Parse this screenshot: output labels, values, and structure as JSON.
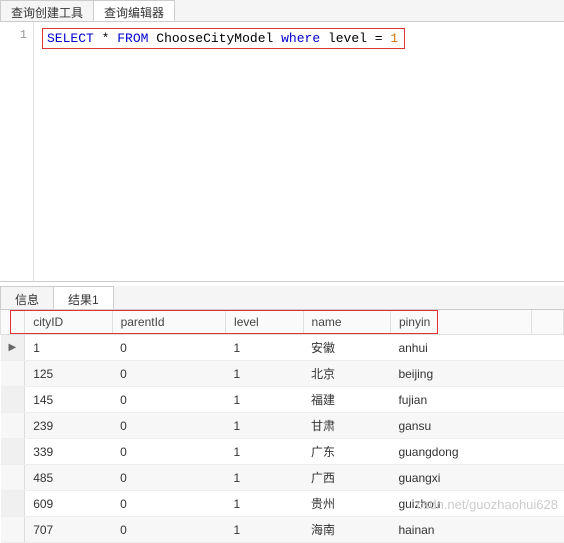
{
  "top_tabs": {
    "create_tool": "查询创建工具",
    "editor": "查询编辑器"
  },
  "editor": {
    "line_number": "1",
    "sql": {
      "kw_select": "SELECT",
      "star": "*",
      "kw_from": "FROM",
      "table": "ChooseCityModel",
      "kw_where": "where",
      "col": "level",
      "eq": "=",
      "val": "1"
    }
  },
  "result_tabs": {
    "info": "信息",
    "result1": "结果1"
  },
  "table": {
    "columns": {
      "cityID": "cityID",
      "parentId": "parentId",
      "level": "level",
      "name": "name",
      "pinyin": "pinyin"
    },
    "rows": [
      {
        "cityID": "1",
        "parentId": "0",
        "level": "1",
        "name": "安徽",
        "pinyin": "anhui"
      },
      {
        "cityID": "125",
        "parentId": "0",
        "level": "1",
        "name": "北京",
        "pinyin": "beijing"
      },
      {
        "cityID": "145",
        "parentId": "0",
        "level": "1",
        "name": "福建",
        "pinyin": "fujian"
      },
      {
        "cityID": "239",
        "parentId": "0",
        "level": "1",
        "name": "甘肃",
        "pinyin": "gansu"
      },
      {
        "cityID": "339",
        "parentId": "0",
        "level": "1",
        "name": "广东",
        "pinyin": "guangdong"
      },
      {
        "cityID": "485",
        "parentId": "0",
        "level": "1",
        "name": "广西",
        "pinyin": "guangxi"
      },
      {
        "cityID": "609",
        "parentId": "0",
        "level": "1",
        "name": "贵州",
        "pinyin": "guizhou"
      },
      {
        "cityID": "707",
        "parentId": "0",
        "level": "1",
        "name": "海南",
        "pinyin": "hainan"
      }
    ]
  },
  "watermark": "csdn.net/guozhaohui628"
}
